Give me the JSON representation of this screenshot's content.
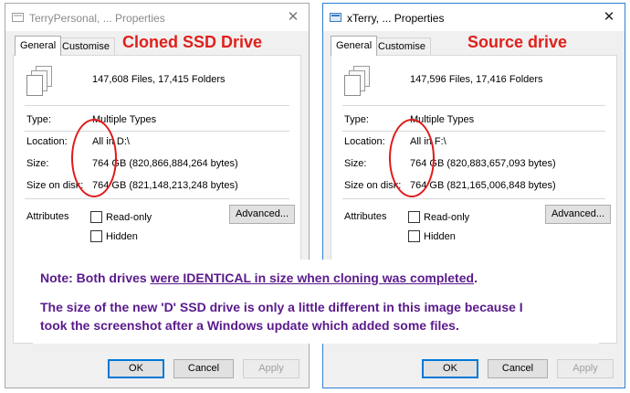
{
  "left_dialog": {
    "title": "TerryPersonal, ... Properties",
    "close_glyph": "✕",
    "tabs": [
      "General",
      "Customise"
    ],
    "files_summary": "147,608 Files, 17,415 Folders",
    "labels": {
      "type": "Type:",
      "location": "Location:",
      "size": "Size:",
      "size_on_disk": "Size on disk:",
      "attributes": "Attributes"
    },
    "values": {
      "type": "Multiple Types",
      "location": "All in D:\\",
      "size": "764 GB (820,866,884,264 bytes)",
      "size_on_disk": "764 GB (821,148,213,248 bytes)"
    },
    "read_only_label": "Read-only",
    "hidden_label": "Hidden",
    "advanced_label": "Advanced...",
    "ok_label": "OK",
    "cancel_label": "Cancel",
    "apply_label": "Apply"
  },
  "right_dialog": {
    "title": "xTerry, ... Properties",
    "close_glyph": "✕",
    "tabs": [
      "General",
      "Customise"
    ],
    "files_summary": "147,596 Files, 17,416 Folders",
    "labels": {
      "type": "Type:",
      "location": "Location:",
      "size": "Size:",
      "size_on_disk": "Size on disk:",
      "attributes": "Attributes"
    },
    "values": {
      "type": "Multiple Types",
      "location": "All in F:\\",
      "size": "764 GB (820,883,657,093 bytes)",
      "size_on_disk": "764 GB (821,165,006,848 bytes)"
    },
    "read_only_label": "Read-only",
    "hidden_label": "Hidden",
    "advanced_label": "Advanced...",
    "ok_label": "OK",
    "cancel_label": "Cancel",
    "apply_label": "Apply"
  },
  "annotations": {
    "left_heading": "Cloned SSD Drive",
    "right_heading": "Source drive",
    "note_prefix": "Note: Both drives ",
    "note_underlined": "were IDENTICAL in size when cloning was completed",
    "note_suffix": ".",
    "explanation_line1": "The size of the new 'D' SSD drive is only a  little different in this image because I",
    "explanation_line2": "took the screenshot after a Windows update which added some files."
  },
  "colors": {
    "annotation_red": "#e0201a",
    "note_purple": "#5a1a8c",
    "active_window_border": "#2f7fd6",
    "primary_button_border": "#0078d7"
  },
  "icons": {
    "title": "drive-properties-icon",
    "close": "close-icon",
    "files": "multiple-files-icon"
  }
}
